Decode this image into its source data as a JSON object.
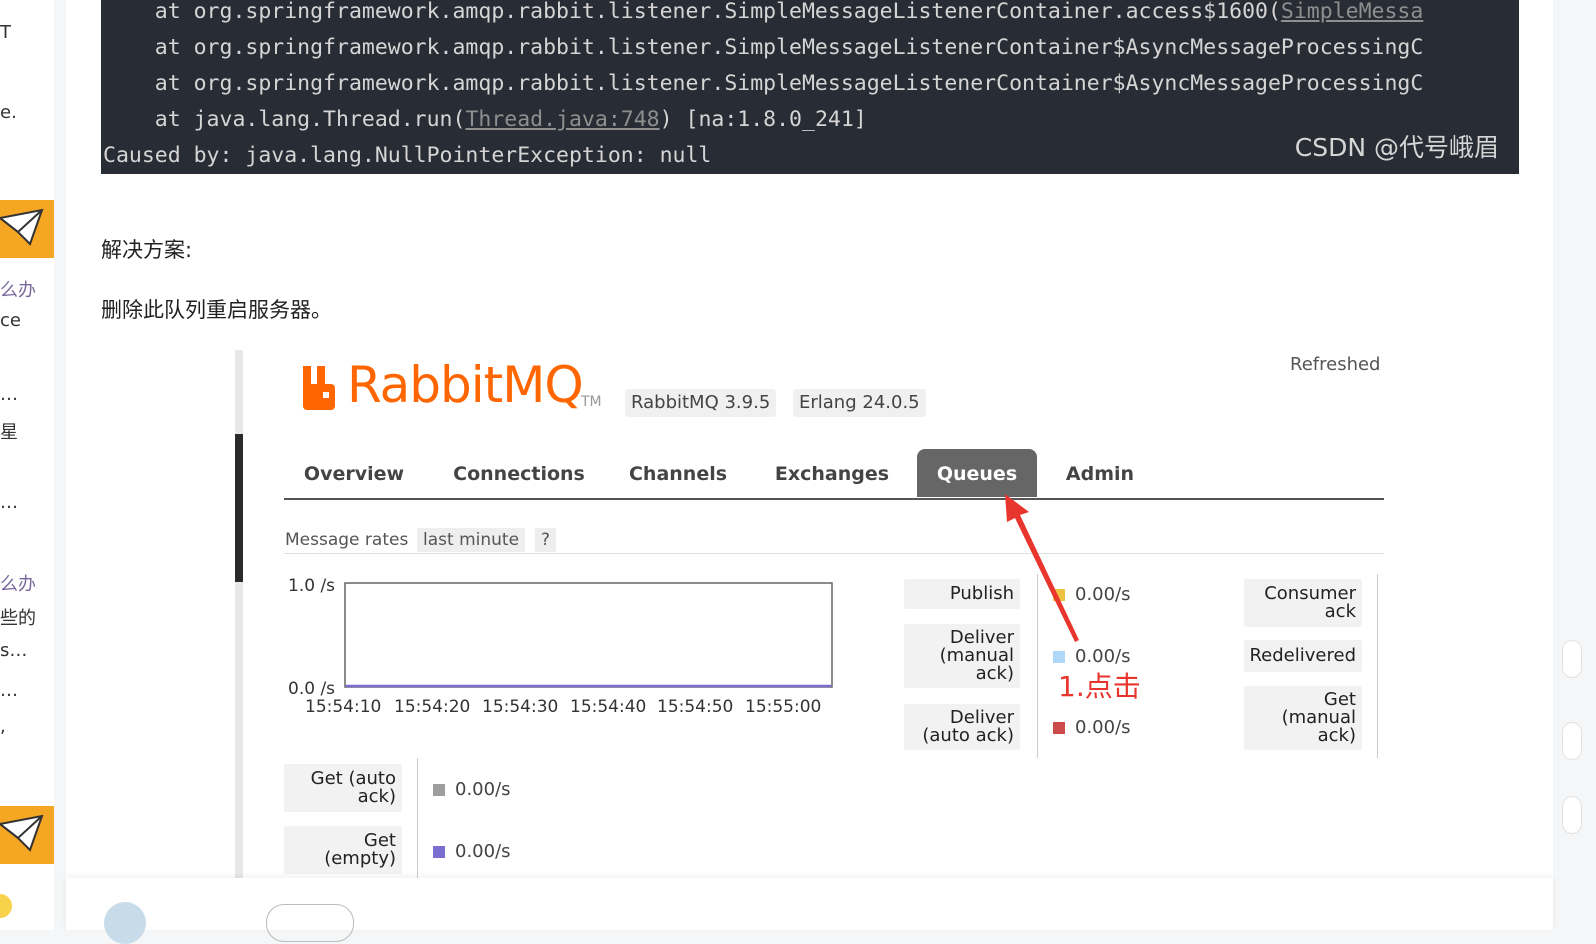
{
  "sidebar": {
    "fragments": [
      "T",
      "e.",
      "么办",
      "ce",
      "…",
      "星",
      "…",
      "么办",
      "些的",
      "s…",
      "…",
      ","
    ]
  },
  "code": {
    "lines": [
      {
        "prefix": "    at org.springframework.amqp.rabbit.listener.SimpleMessageListenerContainer.access$1600(",
        "link": "SimpleMessa",
        "suffix": ""
      },
      {
        "prefix": "    at org.springframework.amqp.rabbit.listener.SimpleMessageListenerContainer$AsyncMessageProcessingC",
        "link": "",
        "suffix": ""
      },
      {
        "prefix": "    at org.springframework.amqp.rabbit.listener.SimpleMessageListenerContainer$AsyncMessageProcessingC",
        "link": "",
        "suffix": ""
      },
      {
        "prefix": "    at java.lang.Thread.run(",
        "link": "Thread.java:748",
        "suffix": ") [na:1.8.0_241]"
      },
      {
        "prefix": "Caused by: java.lang.NullPointerException: null",
        "link": "",
        "suffix": ""
      }
    ],
    "watermark": "CSDN @代号峨眉"
  },
  "article": {
    "heading": "解决方案:",
    "text": "删除此队列重启服务器。"
  },
  "rabbitmq": {
    "logo_text": "RabbitMQ",
    "logo_tm": "TM",
    "version": "RabbitMQ 3.9.5",
    "erlang": "Erlang 24.0.5",
    "refreshed": "Refreshed",
    "tabs": [
      "Overview",
      "Connections",
      "Channels",
      "Exchanges",
      "Queues",
      "Admin"
    ],
    "active_tab": "Queues",
    "rates_label": "Message rates",
    "rates_period": "last minute",
    "rates_help": "?",
    "chart_y_max": "1.0 /s",
    "chart_y_min": "0.0 /s",
    "chart_x_ticks": [
      "15:54:10",
      "15:54:20",
      "15:54:30",
      "15:54:40",
      "15:54:50",
      "15:55:00"
    ],
    "metrics": {
      "publish": {
        "label": "Publish",
        "value": "0.00/s",
        "color": "#edc240"
      },
      "deliver_manual": {
        "label": "Deliver (manual ack)",
        "value": "0.00/s",
        "color": "#afd8f8"
      },
      "deliver_auto": {
        "label": "Deliver (auto ack)",
        "value": "0.00/s",
        "color": "#cb4b4b"
      },
      "get_auto": {
        "label": "Get (auto ack)",
        "value": "0.00/s",
        "color": "#9e9e9e"
      },
      "get_empty": {
        "label": "Get (empty)",
        "value": "0.00/s",
        "color": "#7a6fd1"
      },
      "consumer_ack": {
        "label": "Consumer ack"
      },
      "redelivered": {
        "label": "Redelivered"
      },
      "get_manual": {
        "label": "Get (manual ack)"
      }
    },
    "annotation": "1.点击"
  },
  "colors": {
    "code_bg": "#282c34",
    "rabbit_orange": "#ff6600",
    "badge_orange": "#f5a623",
    "annotation_red": "#e8352e"
  }
}
